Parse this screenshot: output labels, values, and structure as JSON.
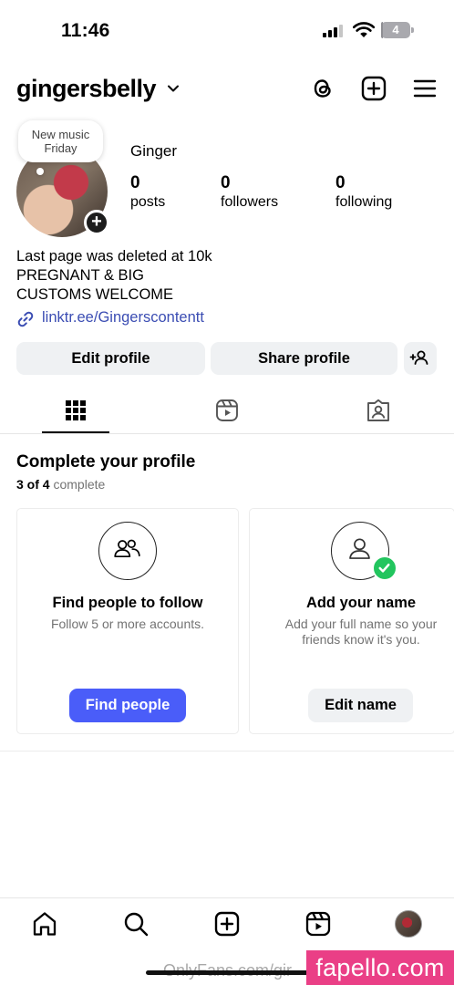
{
  "status_bar": {
    "time": "11:46",
    "battery_level": "4",
    "battery_fraction": 0.04
  },
  "header": {
    "username": "gingersbelly"
  },
  "profile": {
    "note_lines": [
      "New music",
      "Friday"
    ],
    "display_name": "Ginger",
    "stats": [
      {
        "value": "0",
        "label": "posts"
      },
      {
        "value": "0",
        "label": "followers"
      },
      {
        "value": "0",
        "label": "following"
      }
    ],
    "bio_lines": [
      "Last page was deleted at 10k",
      "PREGNANT & BIG",
      "CUSTOMS WELCOME"
    ],
    "link": "linktr.ee/Gingerscontentt"
  },
  "buttons": {
    "edit_profile": "Edit profile",
    "share_profile": "Share profile"
  },
  "tabs": [
    {
      "icon": "grid-icon",
      "active": true
    },
    {
      "icon": "reels-icon",
      "active": false
    },
    {
      "icon": "tagged-icon",
      "active": false
    }
  ],
  "complete_profile": {
    "title": "Complete your profile",
    "progress_count": "3 of 4",
    "progress_suffix": "complete",
    "cards": [
      {
        "icon": "people-icon",
        "title": "Find people to follow",
        "description": "Follow 5 or more accounts.",
        "button": "Find people",
        "done": false
      },
      {
        "icon": "user-icon",
        "title": "Add your name",
        "description": "Add your full name so your friends know it's you.",
        "button": "Edit name",
        "done": true
      }
    ]
  },
  "bottom_nav": [
    "home-icon",
    "search-icon",
    "create-icon",
    "reels-icon",
    "profile-avatar"
  ],
  "watermark": {
    "text": "OnlyFans.com/gir",
    "badge": "fapello.com"
  },
  "colors": {
    "link": "#3b4db3",
    "primary_button": "#4a5df9",
    "secondary_button": "#eff1f3",
    "check": "#22c55e",
    "watermark_badge": "#ea3f86"
  }
}
